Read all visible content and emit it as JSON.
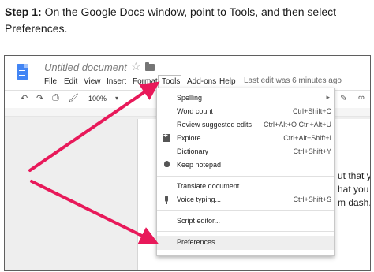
{
  "instruction": {
    "step_label": "Step 1:",
    "text": " On the Google Docs window, point to Tools, and then select Preferences."
  },
  "docs": {
    "title": "Untitled document",
    "menu": [
      "File",
      "Edit",
      "View",
      "Insert",
      "Format",
      "Tools",
      "Add-ons",
      "Help"
    ],
    "last_edit": "Last edit was 6 minutes ago",
    "zoom": "100%",
    "doc_lines": [
      "ut that yo",
      "hat you ca",
      "m dash."
    ]
  },
  "tools_menu": {
    "items": [
      {
        "label": "Spelling",
        "shortcut": "",
        "icon": "",
        "submenu": true
      },
      {
        "label": "Word count",
        "shortcut": "Ctrl+Shift+C",
        "icon": ""
      },
      {
        "label": "Review suggested edits",
        "shortcut": "Ctrl+Alt+O Ctrl+Alt+U",
        "icon": ""
      },
      {
        "label": "Explore",
        "shortcut": "Ctrl+Alt+Shift+I",
        "icon": "explore-icon"
      },
      {
        "label": "Dictionary",
        "shortcut": "Ctrl+Shift+Y",
        "icon": ""
      },
      {
        "label": "Keep notepad",
        "shortcut": "",
        "icon": "bulb-icon"
      },
      {
        "label": "Translate document...",
        "shortcut": "",
        "icon": ""
      },
      {
        "label": "Voice typing...",
        "shortcut": "Ctrl+Shift+S",
        "icon": "mic-icon"
      },
      {
        "label": "Script editor...",
        "shortcut": "",
        "icon": ""
      },
      {
        "label": "Preferences...",
        "shortcut": "",
        "icon": "",
        "highlighted": true
      }
    ]
  },
  "colors": {
    "arrow": "#e8195a",
    "docs_blue": "#4285f4"
  }
}
